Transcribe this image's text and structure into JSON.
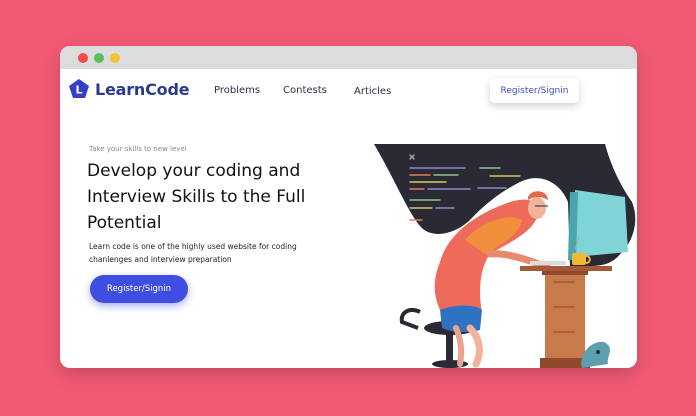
{
  "window": {
    "traffic_lights": [
      "red",
      "green",
      "yellow"
    ]
  },
  "brand": {
    "name": "LearnCode",
    "logo_letter": "L",
    "color": "#2d3a8c"
  },
  "nav": {
    "links": [
      "Problems",
      "Contests",
      "Articles"
    ],
    "register_label": "Register/Signin"
  },
  "hero": {
    "tagline": "Take your skills to new level",
    "headline": "Develop your coding and Interview Skills to the Full Potential",
    "description": "Learn code is one of the highly used website for coding chanlenges and  interview preparation",
    "cta_label": "Register/Signin"
  },
  "colors": {
    "background": "#f25a74",
    "accent": "#3f4de0",
    "illustration_dark": "#2a2a35"
  },
  "icons": [
    "logo-icon",
    "developer-illustration"
  ]
}
